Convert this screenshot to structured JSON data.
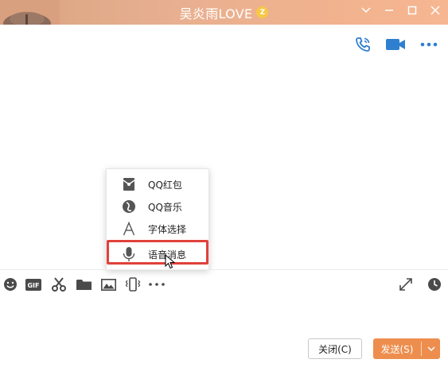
{
  "window": {
    "title": "吴炎雨LOVE",
    "badge": "Z",
    "accent_color": "#f0b28e"
  },
  "header_actions": {
    "icons": [
      "phone-icon",
      "video-call-icon",
      "more-icon"
    ],
    "color": "#2f7fd1"
  },
  "popup_menu": {
    "items": [
      {
        "label": "QQ红包",
        "icon": "red-packet-icon"
      },
      {
        "label": "QQ音乐",
        "icon": "music-icon"
      },
      {
        "label": "字体选择",
        "icon": "font-icon"
      },
      {
        "label": "语音消息",
        "icon": "microphone-icon",
        "highlighted": true
      }
    ],
    "highlight_color": "#e0413a"
  },
  "toolbar": {
    "icons": [
      "emoji-icon",
      "gif-icon",
      "scissors-icon",
      "folder-icon",
      "image-icon",
      "shake-icon",
      "more-dots-icon"
    ],
    "gif_label": "GIF",
    "right_icons": [
      "expand-icon",
      "history-icon"
    ]
  },
  "footer": {
    "close_label": "关闭(C)",
    "send_label": "发送(S)",
    "send_color": "#ee8e4e"
  }
}
